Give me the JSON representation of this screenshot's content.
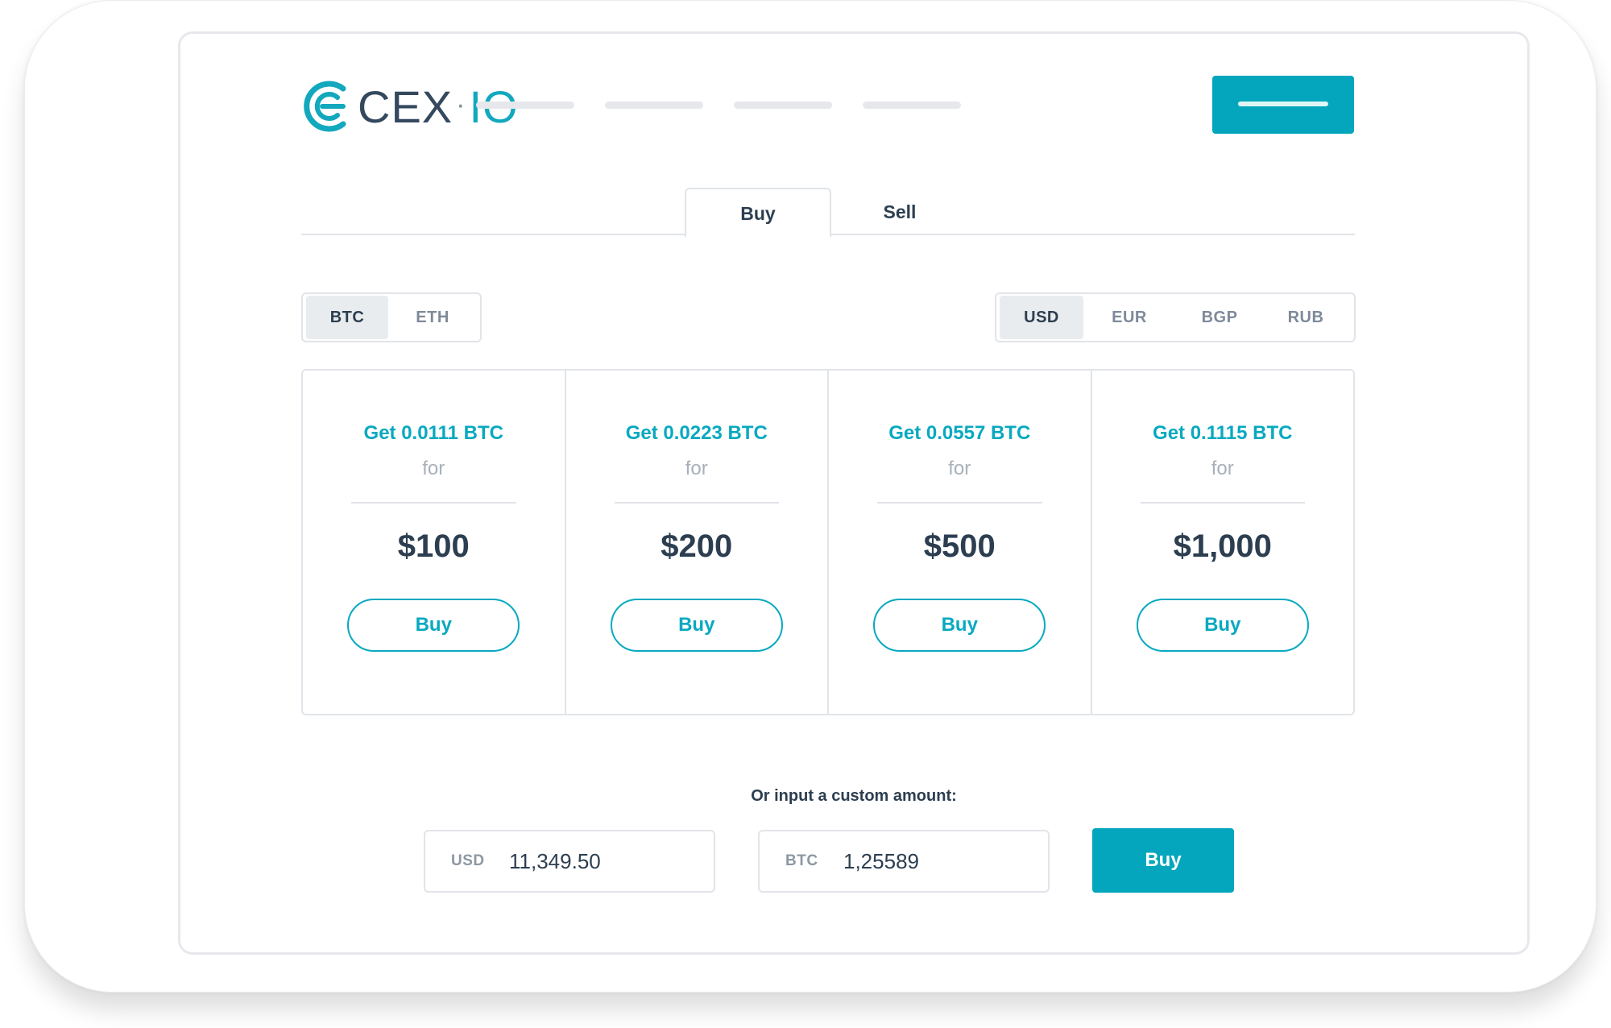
{
  "header": {
    "logo_prefix": "CEX",
    "logo_dot": "·",
    "logo_suffix": "IO",
    "logo_icon": "cex-io-logo-icon",
    "accent_color": "#03a6bc"
  },
  "tabs": [
    {
      "label": "Buy",
      "active": true
    },
    {
      "label": "Sell",
      "active": false
    }
  ],
  "crypto_selector": {
    "options": [
      "BTC",
      "ETH"
    ],
    "selected": "BTC"
  },
  "fiat_selector": {
    "options": [
      "USD",
      "EUR",
      "BGP",
      "RUB"
    ],
    "selected": "USD"
  },
  "packages": [
    {
      "get": "Get 0.0111 BTC",
      "for": "for",
      "price": "$100",
      "button": "Buy"
    },
    {
      "get": "Get 0.0223 BTC",
      "for": "for",
      "price": "$200",
      "button": "Buy"
    },
    {
      "get": "Get 0.0557 BTC",
      "for": "for",
      "price": "$500",
      "button": "Buy"
    },
    {
      "get": "Get 0.1115 BTC",
      "for": "for",
      "price": "$1,000",
      "button": "Buy"
    }
  ],
  "custom": {
    "label": "Or input a custom amount:",
    "fiat_currency": "USD",
    "fiat_value": "11,349.50",
    "crypto_currency": "BTC",
    "crypto_value": "1,25589",
    "button": "Buy"
  }
}
